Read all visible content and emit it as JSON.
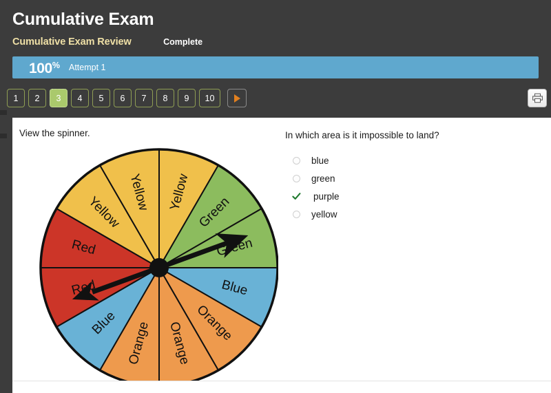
{
  "header": {
    "exam_title": "Cumulative Exam",
    "review_label": "Cumulative Exam Review",
    "status_label": "Complete",
    "score": "100",
    "percent_symbol": "%",
    "attempt_label": "Attempt 1",
    "progress_color": "#5fa8ce",
    "background_color": "#3c3c3c",
    "review_color": "#efe0a6"
  },
  "pager": {
    "items": [
      {
        "label": "1",
        "active": false
      },
      {
        "label": "2",
        "active": false
      },
      {
        "label": "3",
        "active": true
      },
      {
        "label": "4",
        "active": false
      },
      {
        "label": "5",
        "active": false
      },
      {
        "label": "6",
        "active": false
      },
      {
        "label": "7",
        "active": false
      },
      {
        "label": "8",
        "active": false
      },
      {
        "label": "9",
        "active": false
      },
      {
        "label": "10",
        "active": false
      }
    ],
    "next_icon": "play-triangle-icon",
    "active_color": "#aac96c",
    "border_color": "#8f9e54",
    "next_arrow_color": "#e2801f"
  },
  "toolbar": {
    "print_icon": "printer-icon"
  },
  "main": {
    "prompt": "View the spinner.",
    "question": "In which area is it impossible to land?",
    "options": [
      {
        "label": "blue",
        "selected": false,
        "marker": "radio"
      },
      {
        "label": "green",
        "selected": false,
        "marker": "radio"
      },
      {
        "label": "purple",
        "selected": true,
        "marker": "check-icon"
      },
      {
        "label": "yellow",
        "selected": false,
        "marker": "radio"
      }
    ],
    "check_color": "#1f7a2e"
  },
  "chart_data": {
    "type": "pie",
    "title": "Spinner",
    "description": "Twelve equal sectors of 30 degrees each, read clockwise starting at 12 o'clock.",
    "sector_count": 12,
    "sector_angle_degrees": 30,
    "categories": [
      "Yellow",
      "Green",
      "Green",
      "Blue",
      "Orange",
      "Orange",
      "Orange",
      "Blue",
      "Red",
      "Red",
      "Yellow",
      "Yellow"
    ],
    "values": [
      30,
      30,
      30,
      30,
      30,
      30,
      30,
      30,
      30,
      30,
      30,
      30
    ],
    "color_counts": {
      "Yellow": 3,
      "Green": 2,
      "Blue": 2,
      "Orange": 3,
      "Red": 2
    },
    "colors": {
      "Yellow": "#f0c04b",
      "Green": "#8cbc5e",
      "Blue": "#69b2d6",
      "Orange": "#ee9a4d",
      "Red": "#cc3528",
      "outline": "#111111",
      "pointer": "#111111"
    },
    "pointer": {
      "label": "double-headed spinner arrow",
      "head_direction_degrees": 70,
      "head_landing_sector": "Green",
      "tail_landing_sector": "Red"
    },
    "legend": false,
    "grid": false
  }
}
